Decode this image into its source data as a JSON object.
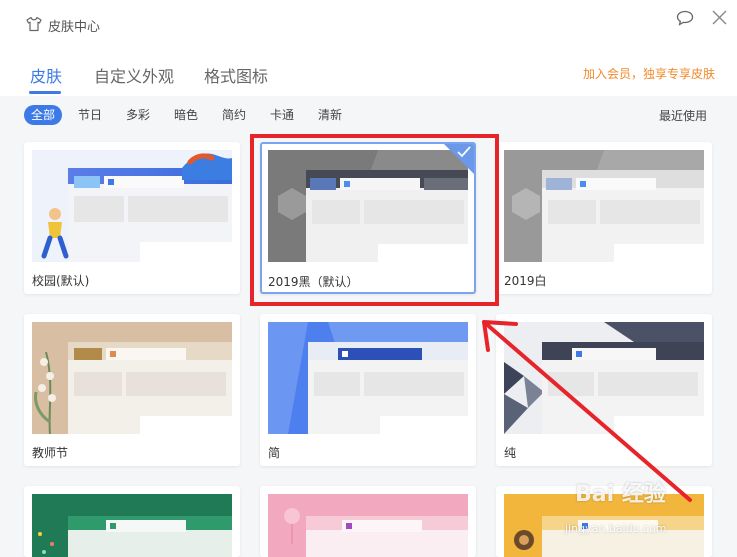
{
  "window": {
    "title": "皮肤中心"
  },
  "tabs": [
    {
      "label": "皮肤"
    },
    {
      "label": "自定义外观"
    },
    {
      "label": "格式图标"
    }
  ],
  "vip_link": "加入会员，独享专享皮肤",
  "filters": [
    {
      "label": "全部"
    },
    {
      "label": "节日"
    },
    {
      "label": "多彩"
    },
    {
      "label": "暗色"
    },
    {
      "label": "简约"
    },
    {
      "label": "卡通"
    },
    {
      "label": "清新"
    }
  ],
  "recent_label": "最近使用",
  "skins": [
    {
      "label": "校园(默认)"
    },
    {
      "label": "2019黑（默认）"
    },
    {
      "label": "2019白"
    },
    {
      "label": "教师节"
    },
    {
      "label": "简"
    },
    {
      "label": "纯"
    }
  ],
  "watermark": {
    "main": "Bai 经验",
    "sub": "jingyan.baidu.com"
  },
  "colors": {
    "accent": "#3d7ae8",
    "vip": "#f08a2a",
    "annotation": "#e8242b"
  }
}
